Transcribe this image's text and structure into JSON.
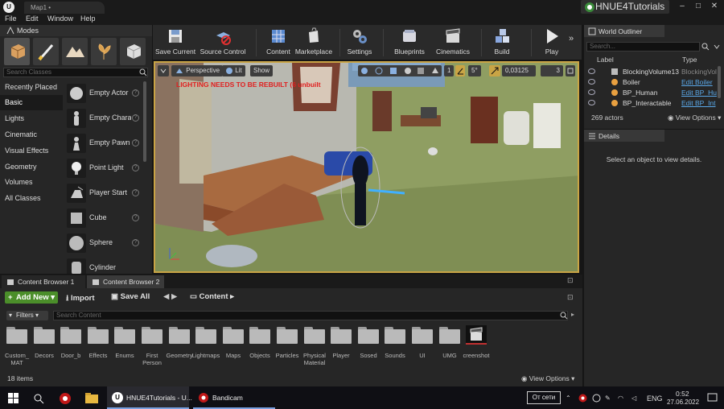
{
  "titlebar": {
    "tab_label": "Map1 •",
    "project_name": "HNUE4Tutorials",
    "logo": "U"
  },
  "menu": [
    "File",
    "Edit",
    "Window",
    "Help"
  ],
  "modes": {
    "title": "Modes",
    "search_placeholder": "Search Classes",
    "categories": [
      "Recently Placed",
      "Basic",
      "Lights",
      "Cinematic",
      "Visual Effects",
      "Geometry",
      "Volumes",
      "All Classes"
    ],
    "active_category": "Basic",
    "items": [
      "Empty Actor",
      "Empty Chara",
      "Empty Pawn",
      "Point Light",
      "Player Start",
      "Cube",
      "Sphere",
      "Cylinder"
    ]
  },
  "toolbar": {
    "buttons": [
      "Save Current",
      "Source Control",
      "Content",
      "Marketplace",
      "Settings",
      "Blueprints",
      "Cinematics",
      "Build",
      "Play"
    ]
  },
  "viewport": {
    "perspective": "Perspective",
    "lit": "Lit",
    "show": "Show",
    "warning": "LIGHTING NEEDS TO BE REBUILT (6 unbuilt",
    "snap_rotation": "1",
    "snap_angle": "5°",
    "camera_speed": "0,03125",
    "grid": "3"
  },
  "outliner": {
    "title": "World Outliner",
    "search_placeholder": "Search...",
    "col_label": "Label",
    "col_type": "Type",
    "rows": [
      {
        "name": "BlockingVolume13",
        "type": "BlockingVol",
        "link": false
      },
      {
        "name": "Boiler",
        "type": "Edit Boiler",
        "link": true
      },
      {
        "name": "BP_Human",
        "type": "Edit BP_Hu",
        "link": true
      },
      {
        "name": "BP_Interactable",
        "type": "Edit BP_Int",
        "link": true
      }
    ],
    "actor_count": "269 actors",
    "view_options": "View Options"
  },
  "details": {
    "title": "Details",
    "message": "Select an object to view details."
  },
  "content_browser": {
    "tabs": [
      "Content Browser 1",
      "Content Browser 2"
    ],
    "add_new": "Add New",
    "import": "Import",
    "save_all": "Save All",
    "path": "Content",
    "filters": "Filters",
    "search_placeholder": "Search Content",
    "folders": [
      "Custom_ MAT",
      "Decors",
      "Door_b",
      "Effects",
      "Enums",
      "First Person",
      "Geometry",
      "Lightmaps",
      "Maps",
      "Objects",
      "Particles",
      "Physical Material",
      "Player",
      "Sosed",
      "Sounds",
      "UI",
      "UMG",
      "creenshot"
    ],
    "items_count": "18 items",
    "view_options": "View Options"
  },
  "taskbar": {
    "app1": "HNUE4Tutorials - U...",
    "app2": "Bandicam",
    "network": "От сети",
    "lang": "ENG",
    "time": "0:52",
    "date": "27.06.2022"
  },
  "colors": {
    "accent_viewport": "#c9a445",
    "add_new": "#4b8e2a",
    "link": "#5aa8e8",
    "warning": "#e02020"
  }
}
